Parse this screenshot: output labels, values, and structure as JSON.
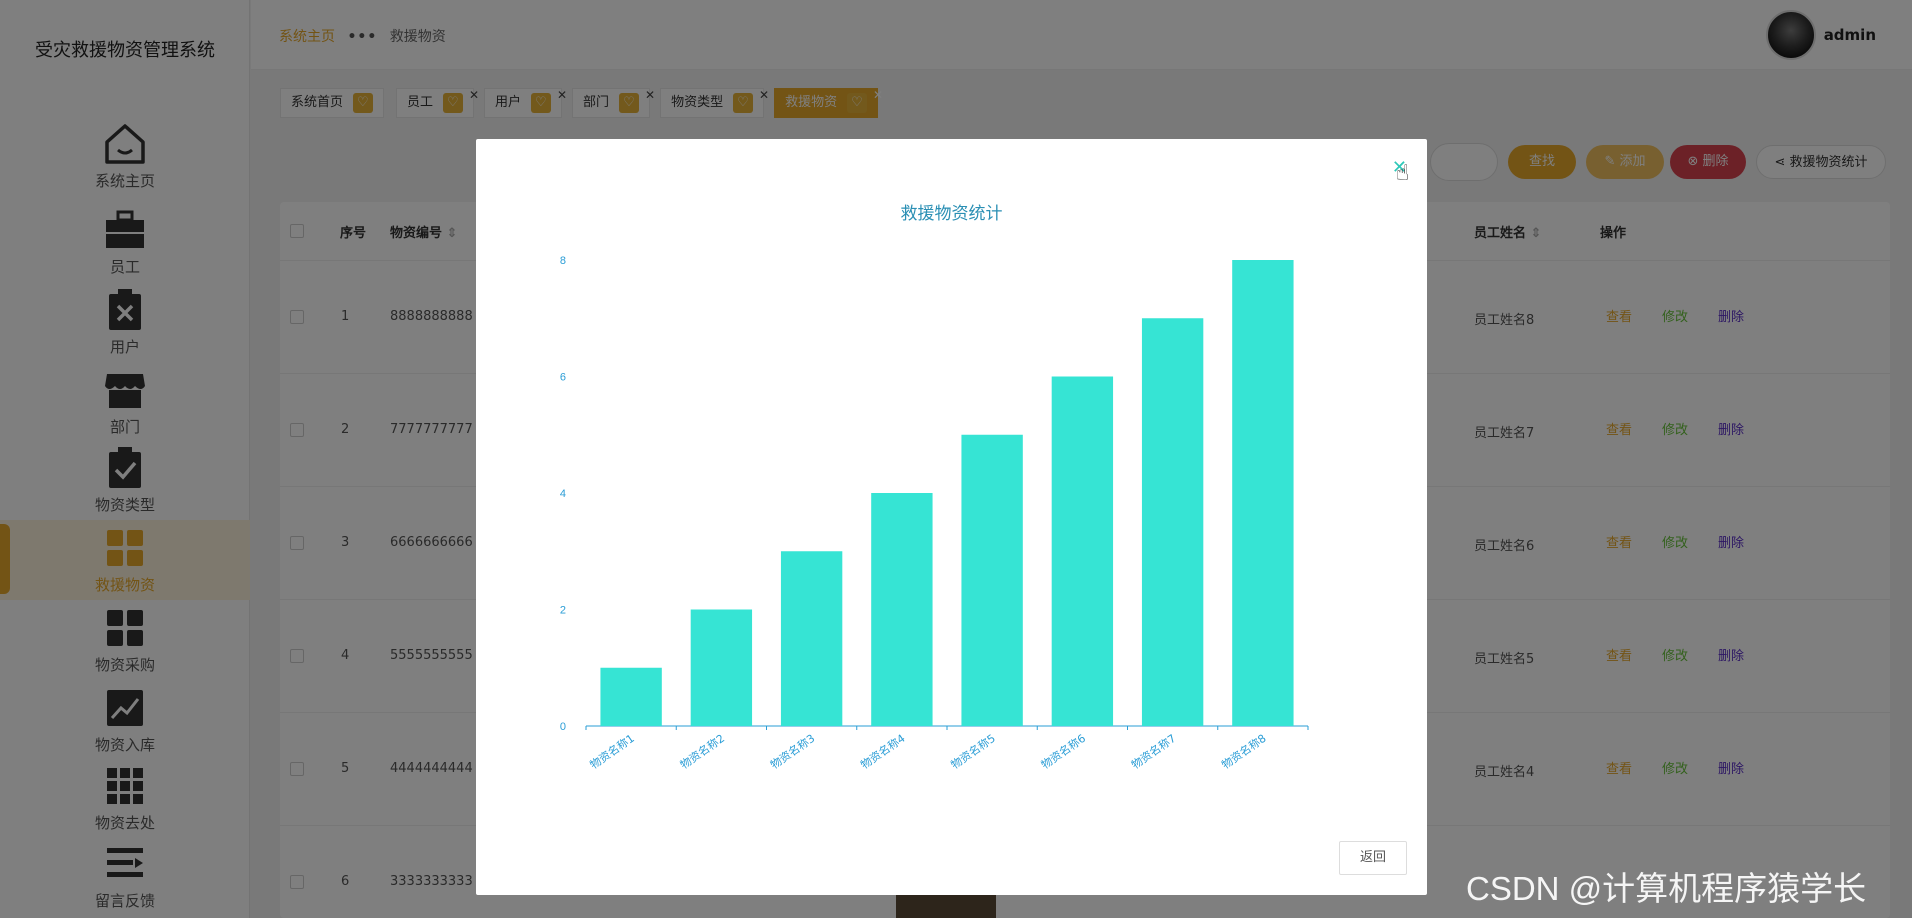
{
  "app": {
    "title": "受灾救援物资管理系统"
  },
  "sidebar": {
    "items": [
      {
        "label": "系统主页",
        "icon": "home-icon"
      },
      {
        "label": "员工",
        "icon": "briefcase-icon"
      },
      {
        "label": "用户",
        "icon": "clipboard-x-icon"
      },
      {
        "label": "部门",
        "icon": "store-icon"
      },
      {
        "label": "物资类型",
        "icon": "clipboard-check-icon"
      },
      {
        "label": "救援物资",
        "icon": "grid-icon"
      },
      {
        "label": "物资采购",
        "icon": "grid-icon"
      },
      {
        "label": "物资入库",
        "icon": "chart-line-icon"
      },
      {
        "label": "物资去处",
        "icon": "grid-9-icon"
      },
      {
        "label": "留言反馈",
        "icon": "list-icon"
      }
    ],
    "active_index": 5
  },
  "header": {
    "breadcrumb_home": "系统主页",
    "breadcrumb_sep": "•••",
    "breadcrumb_current": "救援物资",
    "username": "admin"
  },
  "tabs": [
    {
      "label": "系统首页",
      "closable": false,
      "active": false
    },
    {
      "label": "员工",
      "closable": true,
      "active": false
    },
    {
      "label": "用户",
      "closable": true,
      "active": false
    },
    {
      "label": "部门",
      "closable": true,
      "active": false
    },
    {
      "label": "物资类型",
      "closable": true,
      "active": false
    },
    {
      "label": "救援物资",
      "closable": true,
      "active": true
    }
  ],
  "toolbar": {
    "search_label": "查找",
    "add_label": "添加",
    "delete_label": "删除",
    "stats_label": "救援物资统计",
    "colors": {
      "search": "#e6a82b",
      "add": "#f0c060",
      "delete": "#d9434f"
    }
  },
  "table": {
    "headers": {
      "index": "序号",
      "code": "物资编号",
      "employee": "员工姓名",
      "actions": "操作"
    },
    "rows": [
      {
        "index": "1",
        "code": "8888888888",
        "employee": "员工姓名8"
      },
      {
        "index": "2",
        "code": "7777777777",
        "employee": "员工姓名7"
      },
      {
        "index": "3",
        "code": "6666666666",
        "employee": "员工姓名6"
      },
      {
        "index": "4",
        "code": "5555555555",
        "employee": "员工姓名5"
      },
      {
        "index": "5",
        "code": "4444444444",
        "employee": "员工姓名4"
      },
      {
        "index": "6",
        "code": "3333333333",
        "employee": ""
      }
    ],
    "actions": {
      "view": "查看",
      "edit": "修改",
      "delete": "删除"
    },
    "action_colors": {
      "view": "#e6a82b",
      "edit": "#67c23a",
      "delete": "#5b2ec8"
    }
  },
  "modal": {
    "close_glyph": "✕",
    "back_label": "返回"
  },
  "chart_data": {
    "type": "bar",
    "title": "救援物资统计",
    "categories": [
      "物资名称1",
      "物资名称2",
      "物资名称3",
      "物资名称4",
      "物资名称5",
      "物资名称6",
      "物资名称7",
      "物资名称8"
    ],
    "values": [
      1,
      2,
      3,
      4,
      5,
      6,
      7,
      8
    ],
    "ylim": [
      0,
      8
    ],
    "yticks": [
      0,
      2,
      4,
      6,
      8
    ],
    "bar_color": "#36e4d4",
    "axis_color": "#2a9dd6",
    "grid": false
  },
  "watermark": "CSDN @计算机程序猿学长"
}
